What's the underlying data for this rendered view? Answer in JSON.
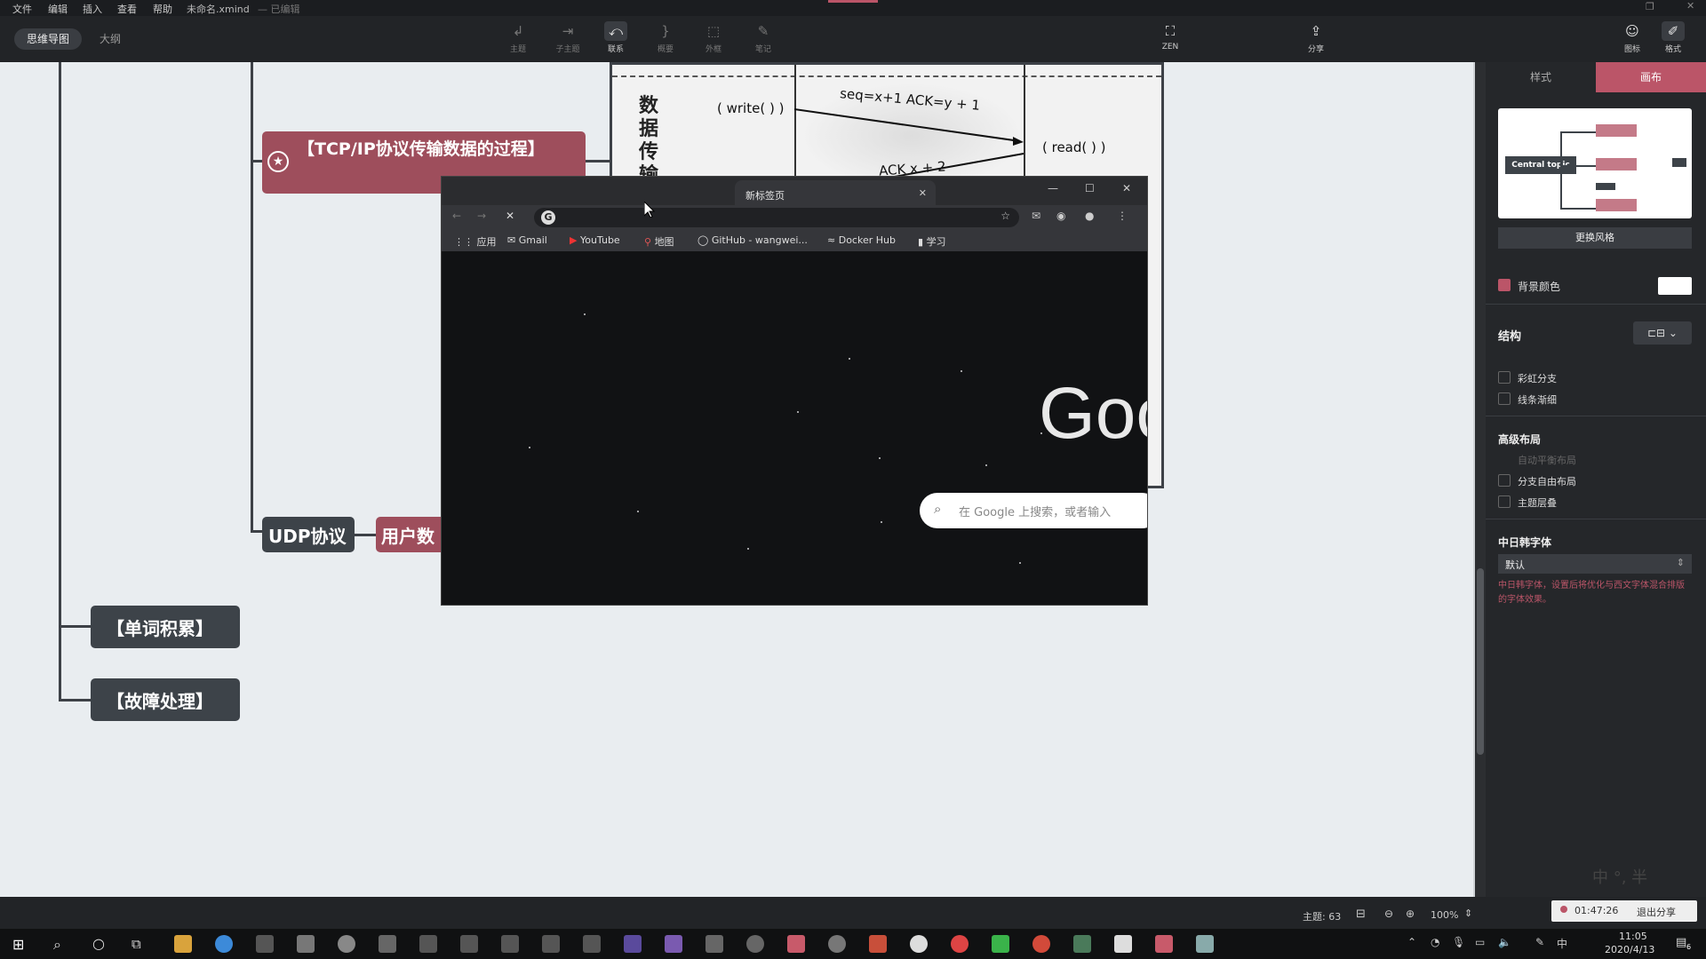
{
  "menubar": {
    "items": [
      "文件",
      "编辑",
      "插入",
      "查看",
      "帮助"
    ],
    "filename": "未命名.xmind",
    "status": "— 已编辑"
  },
  "toolbar": {
    "view_tabs": [
      "思维导图",
      "大纲"
    ],
    "tools": [
      {
        "icon": "topic-icon",
        "label": "主题"
      },
      {
        "icon": "subtopic-icon",
        "label": "子主题"
      },
      {
        "icon": "relationship-icon",
        "label": "联系"
      },
      {
        "icon": "summary-icon",
        "label": "概要"
      },
      {
        "icon": "boundary-icon",
        "label": "外框"
      },
      {
        "icon": "note-icon",
        "label": "笔记"
      }
    ],
    "zen_label": "ZEN",
    "share_label": "分享",
    "icon_label": "图标",
    "format_label": "格式"
  },
  "mindmap": {
    "tcp_topic": "【TCP/IP协议传输数据的过程】",
    "udp_topic": "UDP协议",
    "udp_child": "用户数",
    "vocab_topic": "【单词积累】",
    "fault_topic": "【故障处理】",
    "diagram": {
      "side_label": "数据传输",
      "write_call": "( write( ) )",
      "read_call": "( read( ) )",
      "seq_text": "seq=x+1 ACK=y + 1",
      "ack_text": "ACK x + 2"
    }
  },
  "browser": {
    "tab_title": "新标签页",
    "bookmarks": [
      "应用",
      "Gmail",
      "YouTube",
      "地图",
      "GitHub - wangwei...",
      "Docker Hub",
      "学习"
    ],
    "logo_text": "Goo",
    "search_placeholder": "在 Google 上搜索，或者输入"
  },
  "right_panel": {
    "tabs": [
      "样式",
      "画布"
    ],
    "preview_label": "Central topic",
    "change_style": "更换风格",
    "bg_color": "背景颜色",
    "bg_color_value": "#ffffff",
    "structure": "结构",
    "rainbow_branch": "彩虹分支",
    "line_taper": "线条渐细",
    "advanced_layout": "高级布局",
    "auto_balance": "自动平衡布局",
    "free_layout": "分支自由布局",
    "topic_overlap": "主题层叠",
    "cjk_font_title": "中日韩字体",
    "cjk_font_value": "默认",
    "cjk_font_desc": "中日韩字体，设置后将优化与西文字体混合排版的字体效果。",
    "ime_indicator": "中 °, 半"
  },
  "status": {
    "topic_count": "主题: 63",
    "zoom": "100%",
    "timer": "01:47:26",
    "exit_share": "退出分享"
  },
  "taskbar": {
    "time": "11:05",
    "date": "2020/4/13",
    "tray_ime": "中",
    "notif_count": "6"
  },
  "colors": {
    "accent": "#bb5568",
    "topic_dark": "#3d4349",
    "topic_red": "#9e4e5c"
  }
}
